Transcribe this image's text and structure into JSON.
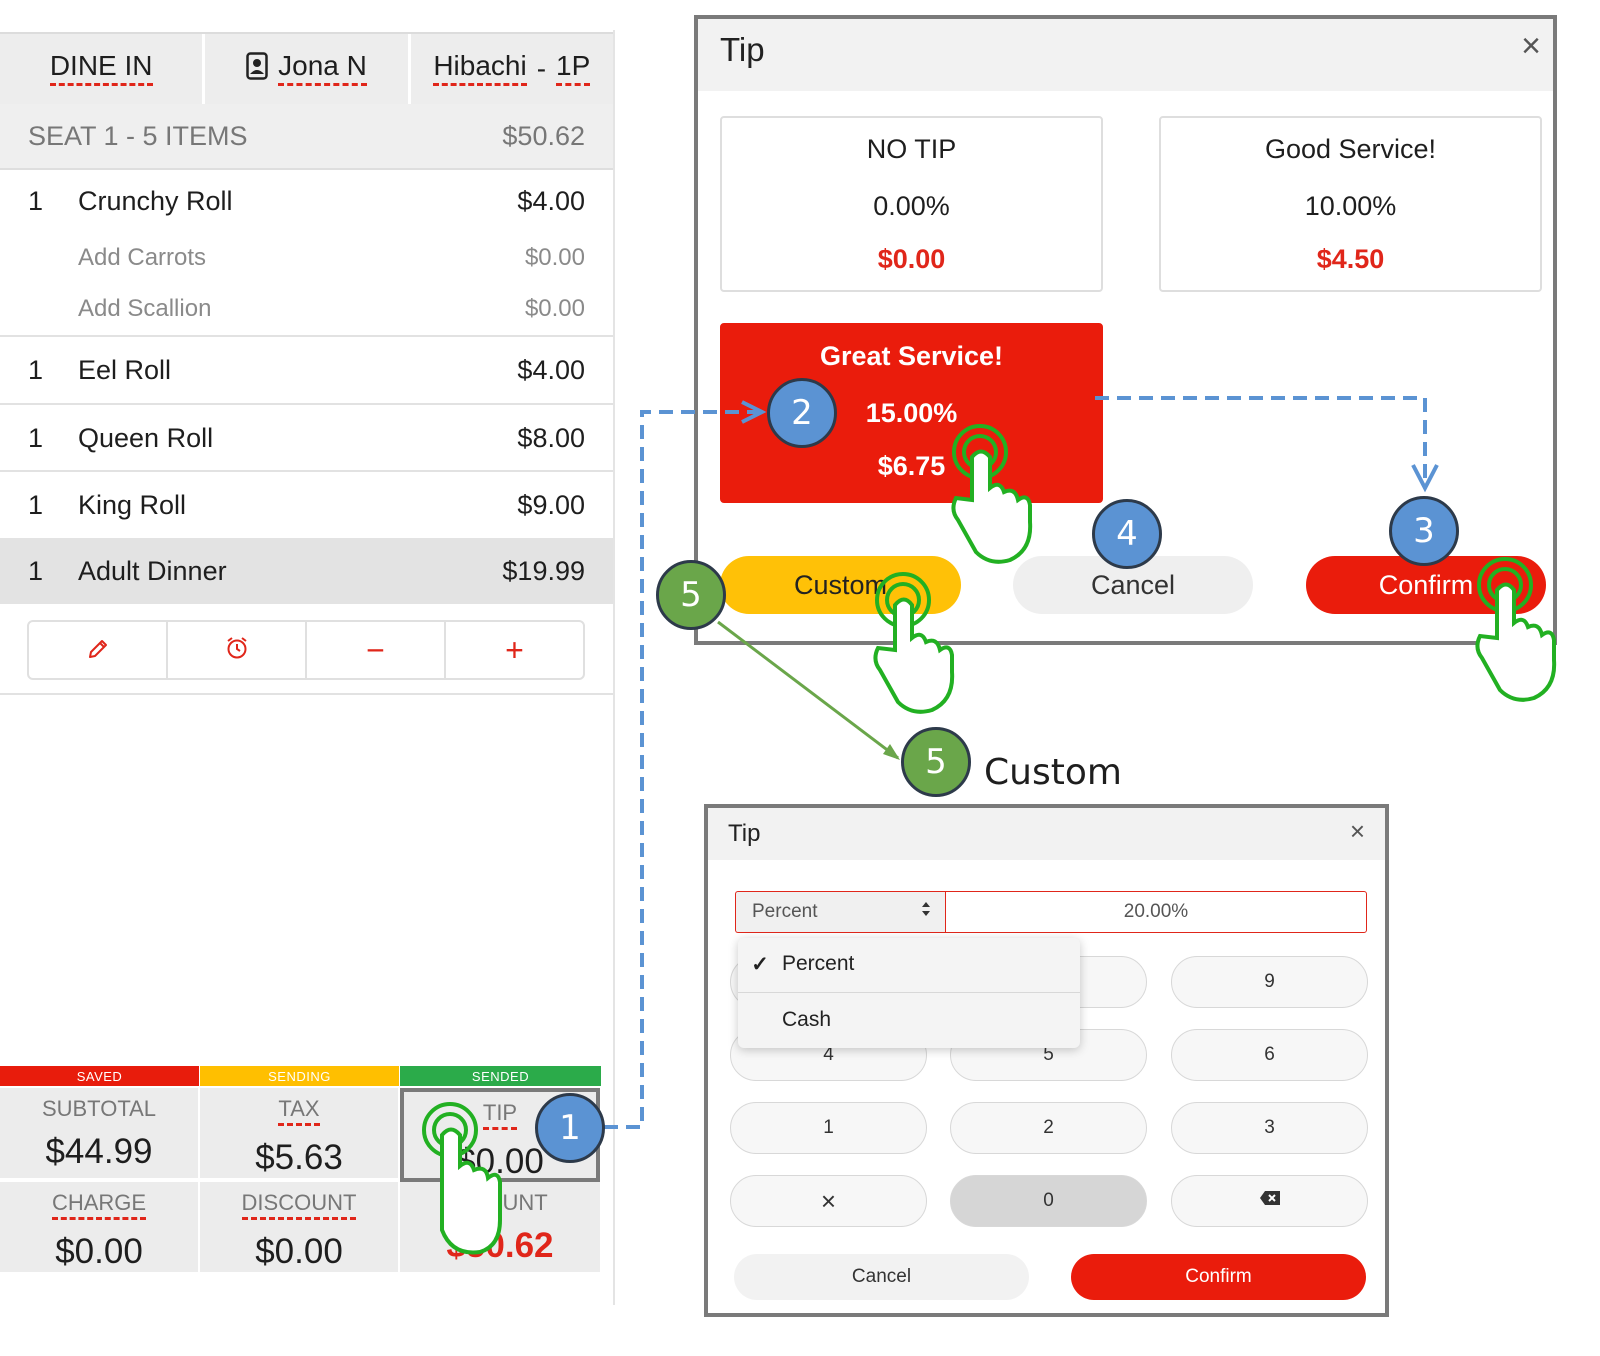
{
  "pos": {
    "tabs": {
      "dine_in": "DINE IN",
      "server": "Jona N",
      "table_part1": "Hibachi",
      "table_sep": "-",
      "table_part2": "1P"
    },
    "seat": {
      "label": "SEAT 1 - 5 ITEMS",
      "total": "$50.62"
    },
    "items": [
      {
        "qty": "1",
        "name": "Crunchy Roll",
        "price": "$4.00",
        "modifiers": [
          {
            "name": "Add Carrots",
            "price": "$0.00"
          },
          {
            "name": "Add Scallion",
            "price": "$0.00"
          }
        ]
      },
      {
        "qty": "1",
        "name": "Eel Roll",
        "price": "$4.00"
      },
      {
        "qty": "1",
        "name": "Queen Roll",
        "price": "$8.00"
      },
      {
        "qty": "1",
        "name": "King Roll",
        "price": "$9.00"
      },
      {
        "qty": "1",
        "name": "Adult Dinner",
        "price": "$19.99"
      }
    ],
    "actions": {
      "edit_icon": "pencil-icon",
      "timer_icon": "alarm-clock-icon",
      "minus": "−",
      "plus": "+"
    },
    "status": {
      "saved": "SAVED",
      "sending": "SENDING",
      "sended": "SENDED"
    },
    "totals": {
      "subtotal_label": "SUBTOTAL",
      "subtotal": "$44.99",
      "tax_label": "TAX",
      "tax": "$5.63",
      "tip_label": "TIP",
      "tip": "$0.00",
      "charge_label": "CHARGE",
      "charge": "$0.00",
      "discount_label": "DISCOUNT",
      "discount": "$0.00",
      "amount_label": "AMOUNT",
      "amount": "$50.62"
    }
  },
  "tip_dialog": {
    "title": "Tip",
    "close": "×",
    "options": [
      {
        "name": "NO TIP",
        "percent": "0.00%",
        "amount": "$0.00"
      },
      {
        "name": "Good Service!",
        "percent": "10.00%",
        "amount": "$4.50"
      },
      {
        "name": "Great Service!",
        "percent": "15.00%",
        "amount": "$6.75"
      }
    ],
    "custom": "Custom",
    "cancel": "Cancel",
    "confirm": "Confirm"
  },
  "custom_dialog": {
    "title": "Tip",
    "close": "×",
    "mode": "Percent",
    "value": "20.00%",
    "menu": {
      "check": "✓",
      "options": [
        "Percent",
        "Cash"
      ]
    },
    "keys": [
      "9",
      "4",
      "5",
      "6",
      "1",
      "2",
      "3",
      "×",
      "0",
      "⌫"
    ],
    "cancel": "Cancel",
    "confirm": "Confirm"
  },
  "annotations": {
    "steps": [
      "1",
      "2",
      "3",
      "4",
      "5",
      "5"
    ],
    "custom_caption": "Custom"
  },
  "colors": {
    "accent_red": "#ea1c0c",
    "custom_yellow": "#ffc107",
    "saved": "#e81c0c",
    "sending": "#ffbf00",
    "sended": "#2bab4a",
    "step_blue": "#5b93d3",
    "step_green": "#6aa64a"
  }
}
